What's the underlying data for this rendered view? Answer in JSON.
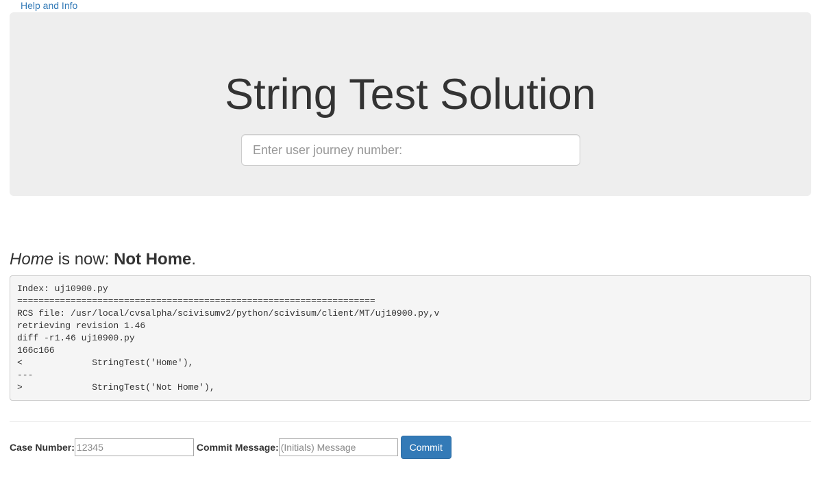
{
  "header": {
    "help_link": "Help and Info"
  },
  "jumbotron": {
    "title": "String Test Solution",
    "journey_input": {
      "placeholder": "Enter user journey number:",
      "value": ""
    }
  },
  "status": {
    "old_value": "Home",
    "middle_text": " is now: ",
    "new_value": "Not Home",
    "end_text": "."
  },
  "diff": {
    "lines": [
      "Index: uj10900.py",
      "===================================================================",
      "RCS file: /usr/local/cvsalpha/scivisumv2/python/scivisum/client/MT/uj10900.py,v",
      "retrieving revision 1.46",
      "diff -r1.46 uj10900.py",
      "166c166",
      "<             StringTest('Home'),",
      "---",
      ">             StringTest('Not Home'),"
    ]
  },
  "commit_form": {
    "case_label": "Case Number:",
    "case_placeholder": "12345",
    "message_label": "Commit Message:",
    "message_placeholder": "(Initials) Message",
    "commit_button": "Commit"
  },
  "colors": {
    "link": "#337ab7",
    "jumbotron_bg": "#eeeeee",
    "button_primary": "#337ab7",
    "code_bg": "#f5f5f5"
  }
}
